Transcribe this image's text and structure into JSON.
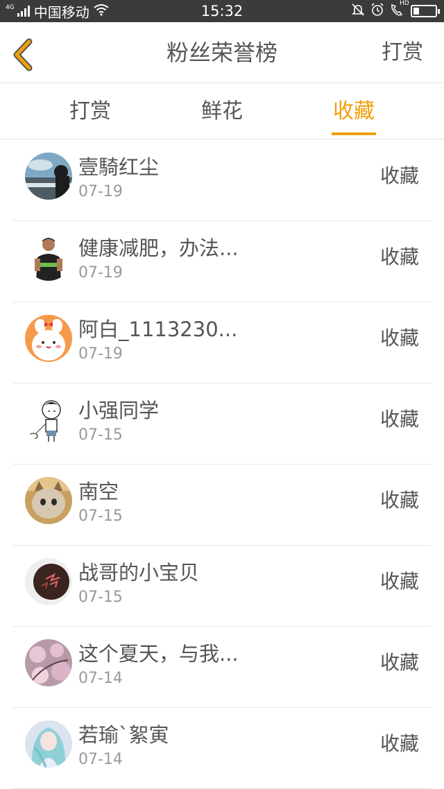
{
  "status_bar": {
    "network": "4G",
    "carrier": "中国移动",
    "time": "15:32",
    "hd": "HD",
    "battery_level": 0.28,
    "icons": [
      "signal-icon",
      "wifi-icon",
      "mute-icon",
      "alarm-icon",
      "hd-call-icon",
      "battery-icon"
    ]
  },
  "header": {
    "back_icon": "chevron-left-icon",
    "title": "粉丝荣誉榜",
    "action": "打赏",
    "back_color": "#f0a00a"
  },
  "tabs": [
    {
      "label": "打赏",
      "active": false
    },
    {
      "label": "鲜花",
      "active": false
    },
    {
      "label": "收藏",
      "active": true
    }
  ],
  "accent_color": "#f0a00a",
  "list": [
    {
      "name": "壹騎红尘",
      "date": "07-19",
      "type": "收藏"
    },
    {
      "name": "健康减肥，办法...",
      "date": "07-19",
      "type": "收藏"
    },
    {
      "name": "阿白_1113230...",
      "date": "07-19",
      "type": "收藏"
    },
    {
      "name": "小强同学",
      "date": "07-15",
      "type": "收藏"
    },
    {
      "name": "南空",
      "date": "07-15",
      "type": "收藏"
    },
    {
      "name": "战哥的小宝贝",
      "date": "07-15",
      "type": "收藏"
    },
    {
      "name": "这个夏天，与我...",
      "date": "07-14",
      "type": "收藏"
    },
    {
      "name": "若瑜`絮寅",
      "date": "07-14",
      "type": "收藏"
    }
  ]
}
